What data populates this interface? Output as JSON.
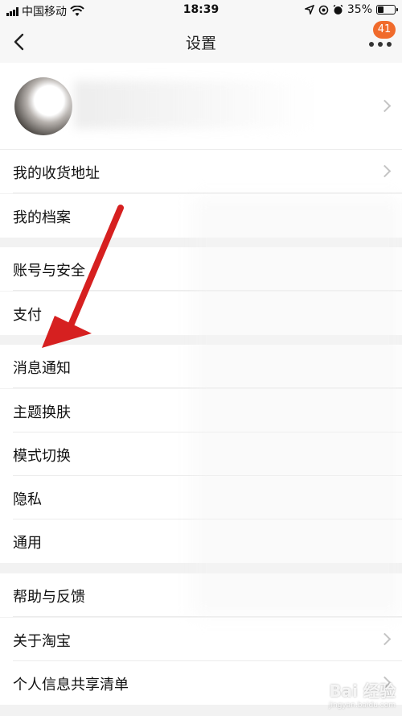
{
  "status_bar": {
    "carrier": "中国移动",
    "time": "18:39",
    "battery": "35%",
    "battery_level": 0.35
  },
  "nav": {
    "title": "设置",
    "badge": "41"
  },
  "settings_rows": [
    {
      "label": "我的收货地址"
    },
    {
      "label": "我的档案"
    },
    {
      "label": "账号与安全"
    },
    {
      "label": "支付"
    },
    {
      "label": "消息通知"
    },
    {
      "label": "主题换肤"
    },
    {
      "label": "模式切换"
    },
    {
      "label": "隐私"
    },
    {
      "label": "通用"
    },
    {
      "label": "帮助与反馈"
    },
    {
      "label": "关于淘宝"
    },
    {
      "label": "个人信息共享清单"
    }
  ],
  "watermark": {
    "brand": "Bai 经验",
    "url": "jingyan.baidu.com"
  },
  "annotation_color": "#d62020"
}
